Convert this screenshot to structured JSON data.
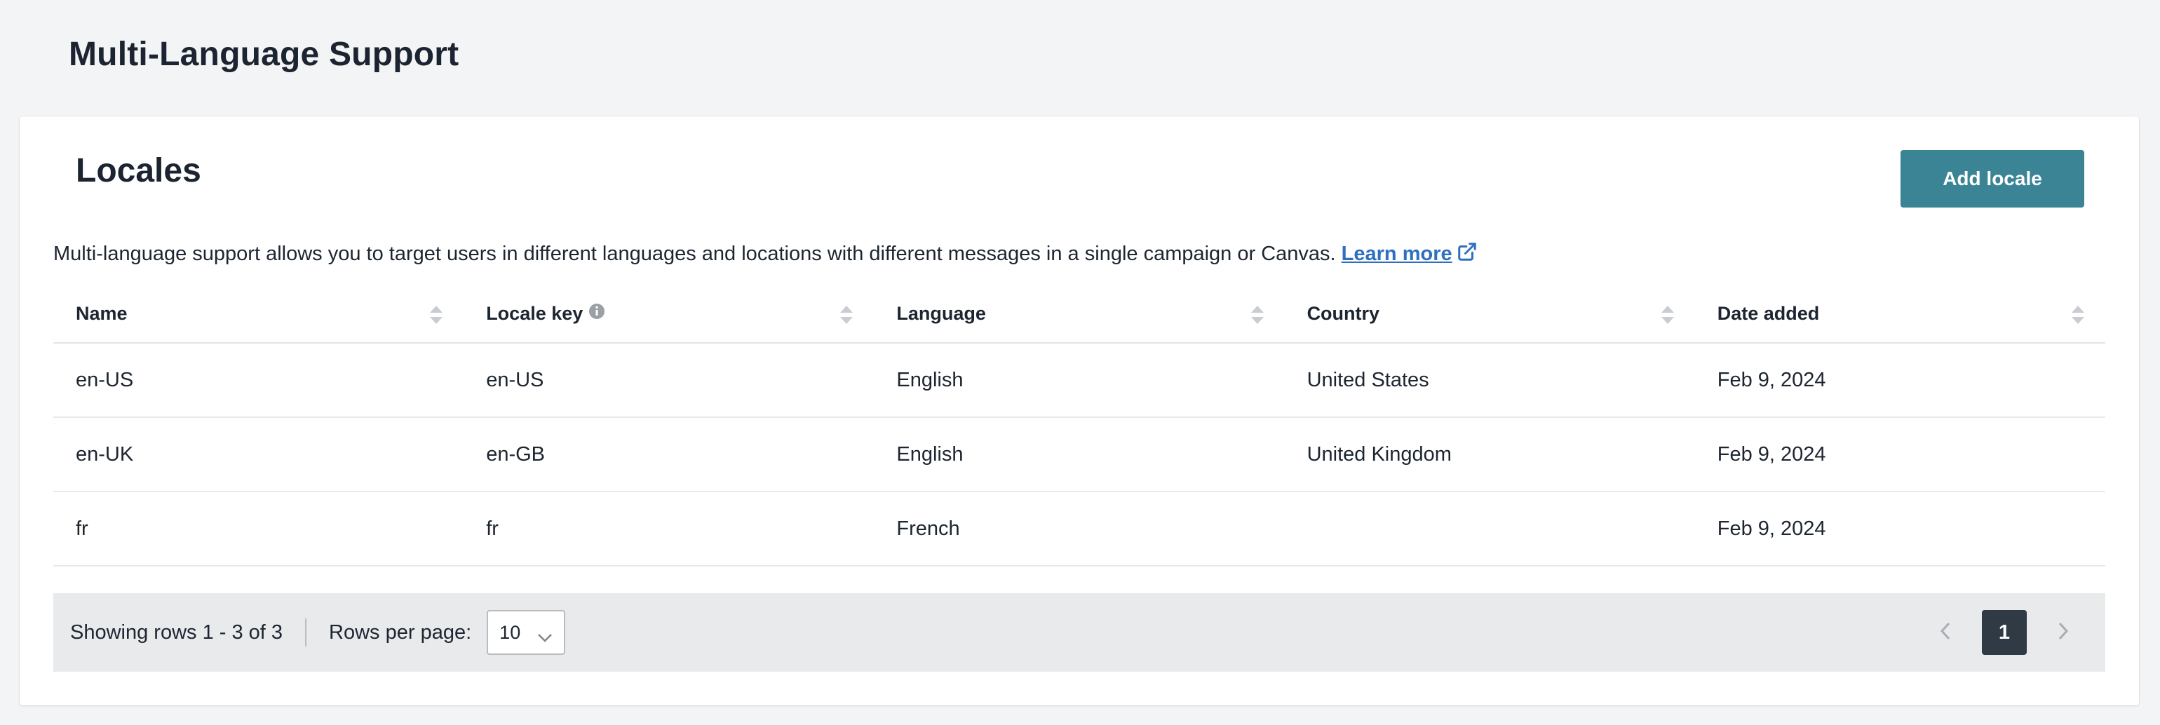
{
  "page": {
    "title": "Multi-Language Support"
  },
  "card": {
    "title": "Locales",
    "add_button": "Add locale",
    "description": "Multi-language support allows you to target users in different languages and locations with different messages in a single campaign or Canvas.",
    "learn_more": "Learn more"
  },
  "table": {
    "columns": [
      {
        "label": "Name",
        "sortable": true
      },
      {
        "label": "Locale key",
        "sortable": true,
        "info_icon": "info-icon"
      },
      {
        "label": "Language",
        "sortable": true
      },
      {
        "label": "Country",
        "sortable": true
      },
      {
        "label": "Date added",
        "sortable": true
      }
    ],
    "rows": [
      [
        "en-US",
        "en-US",
        "English",
        "United States",
        "Feb 9, 2024"
      ],
      [
        "en-UK",
        "en-GB",
        "English",
        "United Kingdom",
        "Feb 9, 2024"
      ],
      [
        "fr",
        "fr",
        "French",
        "",
        "Feb 9, 2024"
      ]
    ]
  },
  "footer": {
    "showing": "Showing rows 1 - 3 of 3",
    "rows_per_page_label": "Rows per page:",
    "rows_per_page_value": "10",
    "current_page": "1"
  },
  "colors": {
    "accent_button": "#3a8496",
    "link": "#2f6fc0",
    "active_page": "#2f3a44",
    "footer_bg": "#e9eaec"
  }
}
